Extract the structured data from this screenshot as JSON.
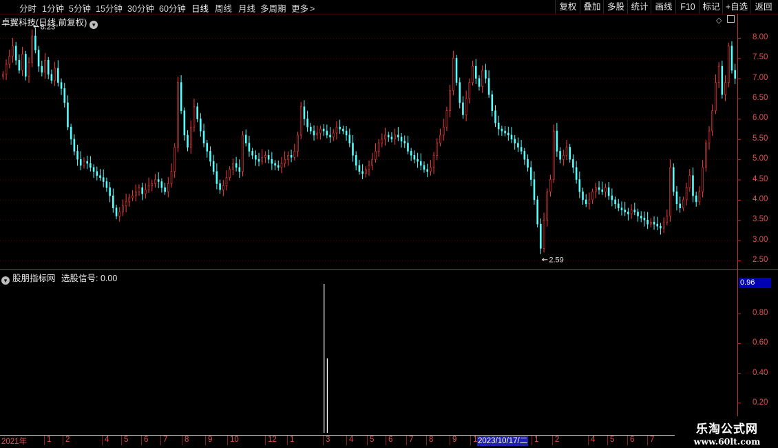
{
  "toolbar": {
    "periods": [
      "分时",
      "1分钟",
      "5分钟",
      "15分钟",
      "30分钟",
      "60分钟",
      "日线",
      "周线",
      "月线",
      "多周期",
      "更多"
    ],
    "active_period": "日线",
    "more_arrow": ">",
    "right_buttons": [
      "复权",
      "叠加",
      "多股",
      "统计",
      "画线",
      "F10",
      "标记",
      "+自选",
      "返回"
    ]
  },
  "main_chart": {
    "title": "卓翼科技(日线,前复权)",
    "dropdown_icon": "chevron-down-icon",
    "diamond_icon": "diamond-icon",
    "panel_icon": "panel-toggle-icon",
    "high_label": "8.23",
    "low_label": "2.59",
    "colors": {
      "up": "#ff3c3c",
      "down": "#54ffff",
      "grid": "#5a0000",
      "axis": "#e05050"
    }
  },
  "indicator": {
    "title": "股朋指标网",
    "signal_label": "选股信号: 0.00",
    "current_value": "0.96",
    "axis_ticks": [
      "0.80",
      "0.60",
      "0.40",
      "0.20"
    ]
  },
  "date_axis": {
    "ticks": [
      "2021年",
      "1",
      "2",
      "4",
      "5",
      "6",
      "7",
      "8",
      "9",
      "10",
      "12",
      "1",
      "3",
      "4",
      "5",
      "6",
      "7",
      "8",
      "9",
      "1",
      "1",
      "2",
      "4",
      "5",
      "6",
      "7"
    ],
    "cursor_date": "2023/10/17/二"
  },
  "watermark": {
    "line1": "乐淘公式网",
    "line2": "www.60lt.com"
  },
  "chart_data": {
    "type": "candlestick",
    "y_axis_ticks": [
      "8.00",
      "7.50",
      "7.00",
      "6.50",
      "6.00",
      "5.50",
      "5.00",
      "4.50",
      "4.00",
      "3.50",
      "3.00",
      "2.50"
    ],
    "ylim": [
      2.5,
      8.3
    ],
    "high": 8.23,
    "low": 2.59,
    "close_series": [
      7.1,
      7.35,
      7.55,
      7.8,
      7.45,
      7.2,
      7.6,
      7.05,
      7.4,
      8.05,
      7.7,
      7.3,
      7.15,
      7.45,
      7.1,
      6.95,
      7.25,
      6.9,
      6.75,
      6.4,
      5.8,
      5.5,
      5.2,
      5.0,
      4.85,
      4.95,
      4.9,
      4.8,
      4.7,
      4.6,
      4.55,
      4.45,
      4.3,
      4.1,
      3.8,
      3.6,
      3.7,
      3.85,
      3.95,
      4.05,
      4.1,
      4.2,
      4.3,
      4.15,
      4.25,
      4.35,
      4.4,
      4.5,
      4.45,
      4.3,
      4.2,
      4.4,
      4.7,
      5.3,
      6.9,
      6.2,
      5.6,
      5.3,
      5.8,
      6.3,
      6.0,
      5.7,
      5.4,
      5.2,
      4.95,
      4.7,
      4.4,
      4.25,
      4.35,
      4.55,
      4.75,
      4.9,
      4.8,
      4.7,
      5.6,
      5.4,
      5.2,
      5.1,
      5.0,
      4.95,
      5.05,
      5.1,
      5.0,
      4.9,
      4.85,
      4.8,
      4.9,
      5.0,
      5.1,
      5.05,
      5.2,
      5.6,
      6.3,
      6.0,
      5.8,
      5.7,
      5.6,
      5.65,
      5.75,
      5.7,
      5.6,
      5.55,
      5.65,
      5.8,
      5.75,
      5.7,
      5.6,
      5.4,
      5.1,
      4.85,
      4.7,
      4.65,
      4.75,
      4.85,
      5.0,
      5.2,
      5.4,
      5.5,
      5.6,
      5.55,
      5.5,
      5.6,
      5.55,
      5.45,
      5.4,
      5.2,
      5.1,
      5.0,
      4.95,
      4.85,
      4.75,
      4.7,
      4.8,
      5.1,
      5.4,
      5.6,
      5.8,
      6.2,
      6.7,
      7.5,
      6.9,
      6.4,
      6.1,
      6.5,
      6.9,
      7.3,
      7.0,
      6.8,
      7.2,
      7.0,
      6.6,
      6.2,
      5.9,
      5.75,
      5.7,
      5.65,
      5.6,
      5.5,
      5.4,
      5.3,
      5.2,
      5.0,
      4.8,
      4.5,
      4.0,
      3.4,
      2.8,
      3.5,
      4.2,
      4.5,
      5.7,
      5.2,
      5.0,
      5.1,
      5.3,
      5.0,
      4.8,
      4.5,
      4.2,
      4.0,
      3.9,
      4.0,
      4.2,
      4.3,
      4.25,
      4.2,
      4.3,
      4.1,
      4.0,
      3.9,
      3.8,
      3.75,
      3.7,
      3.65,
      3.75,
      3.7,
      3.6,
      3.55,
      3.5,
      3.4,
      3.45,
      3.4,
      3.35,
      3.3,
      3.45,
      3.6,
      4.8,
      4.2,
      3.9,
      3.8,
      4.0,
      4.3,
      4.6,
      4.1,
      3.95,
      4.2,
      4.8,
      5.4,
      5.7,
      6.2,
      6.9,
      7.3,
      6.6,
      6.9,
      7.8,
      7.2,
      7.0
    ],
    "indicator_series": {
      "type": "bar",
      "values": [
        0,
        0,
        0,
        0,
        0,
        0,
        0,
        0,
        0,
        0,
        0,
        0,
        0,
        0,
        0,
        0,
        0,
        0,
        0,
        0,
        0,
        0,
        0,
        0,
        0,
        0,
        0,
        0,
        0,
        0,
        0,
        0,
        0,
        0,
        0,
        0,
        0,
        0,
        0,
        0,
        0,
        0,
        0,
        0,
        0,
        0,
        0,
        0,
        0,
        0,
        0,
        0,
        0,
        0,
        0,
        0,
        0,
        0,
        0,
        0,
        0,
        0,
        0,
        0,
        0,
        0,
        0,
        0,
        0,
        0,
        0,
        0,
        0,
        0,
        0,
        0,
        0,
        0,
        0,
        0,
        0,
        0,
        0,
        0,
        0,
        0,
        0,
        0,
        0,
        0,
        0,
        0,
        0,
        0,
        0,
        0,
        0,
        0,
        0,
        0,
        1,
        0.5,
        0,
        0,
        0,
        0,
        0,
        0,
        0,
        0,
        0,
        0,
        0,
        0,
        0,
        0,
        0,
        0,
        0,
        0,
        0,
        0,
        0,
        0,
        0,
        0,
        0,
        0,
        0,
        0,
        0,
        0,
        0,
        0,
        0,
        0,
        0,
        0,
        0,
        0,
        0,
        0,
        0,
        0,
        0,
        0,
        0,
        0,
        0,
        0,
        0,
        0,
        0,
        0,
        0,
        0,
        0,
        0,
        0,
        0,
        0,
        0,
        0,
        0,
        0,
        0,
        0,
        0,
        0,
        0,
        0,
        0,
        0,
        0,
        0,
        0,
        0,
        0,
        0,
        0,
        0,
        0,
        0,
        0,
        0,
        0,
        0,
        0,
        0,
        0,
        0,
        0,
        0,
        0,
        0,
        0,
        0,
        0,
        0,
        0,
        0,
        0,
        0,
        0,
        0,
        0,
        0,
        0,
        0,
        0,
        0,
        0,
        0,
        0,
        0,
        0,
        0,
        0,
        0,
        0,
        0,
        0,
        0,
        0,
        0,
        0,
        0,
        0,
        0
      ],
      "ylim": [
        0,
        1.05
      ]
    }
  }
}
